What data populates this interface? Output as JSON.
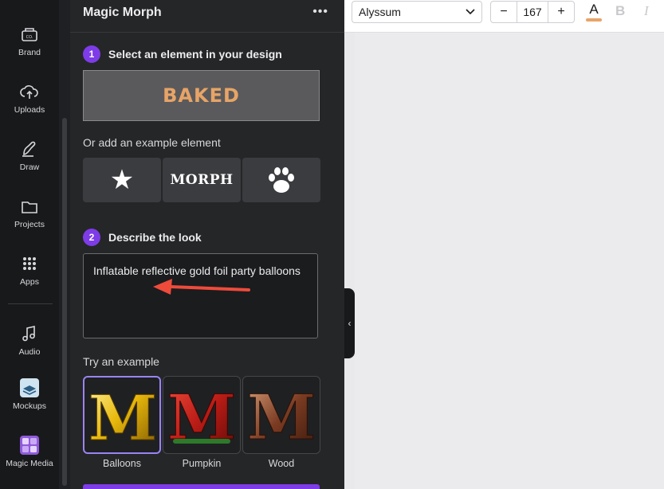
{
  "rail": {
    "items": [
      {
        "label": "Brand",
        "icon": "brand-icon"
      },
      {
        "label": "Uploads",
        "icon": "upload-cloud-icon"
      },
      {
        "label": "Draw",
        "icon": "draw-pen-icon"
      },
      {
        "label": "Projects",
        "icon": "folder-icon"
      },
      {
        "label": "Apps",
        "icon": "apps-grid-icon"
      },
      {
        "label": "Audio",
        "icon": "music-note-icon"
      },
      {
        "label": "Mockups",
        "icon": "mockups-icon"
      },
      {
        "label": "Magic Media",
        "icon": "magic-media-icon"
      }
    ]
  },
  "panel": {
    "title": "Magic Morph",
    "more": "•••",
    "step1": {
      "num": "1",
      "label": "Select an element in your design"
    },
    "selected_text": "BAKED",
    "or_add": "Or add an example element",
    "example_elements": {
      "star": "★",
      "morph": "MORPH",
      "paw": "paw-icon"
    },
    "step2": {
      "num": "2",
      "label": "Describe the look"
    },
    "description": "Inflatable reflective gold foil party balloons",
    "try_example": "Try an example",
    "examples": [
      {
        "label": "Balloons",
        "letter": "M",
        "color": "#e8b90c"
      },
      {
        "label": "Pumpkin",
        "letter": "M",
        "color": "#b81c16"
      },
      {
        "label": "Wood",
        "letter": "M",
        "color": "#7a3b22"
      }
    ],
    "accent": "#7d3ce8",
    "arrow_color": "#ee4b3b"
  },
  "toolbar": {
    "font": "Alyssum",
    "font_size": "167",
    "minus": "−",
    "plus": "+",
    "text_color_glyph": "A",
    "bold": "B",
    "italic": "I",
    "text_color": "#e7a467"
  },
  "collapse": "‹"
}
